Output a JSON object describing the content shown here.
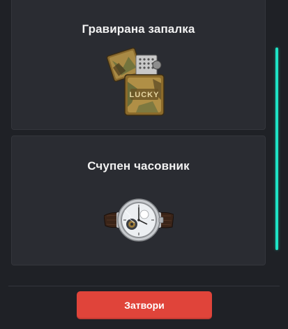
{
  "items": [
    {
      "title": "Гравирана запалка",
      "image_icon": "lighter-icon"
    },
    {
      "title": "Счупен часовник",
      "image_icon": "watch-icon"
    }
  ],
  "footer": {
    "close_label": "Затвори"
  },
  "colors": {
    "background": "#1f2126",
    "card": "#2a2c32",
    "accent_scrollbar": "#1ee3c5",
    "button": "#e0443a"
  }
}
